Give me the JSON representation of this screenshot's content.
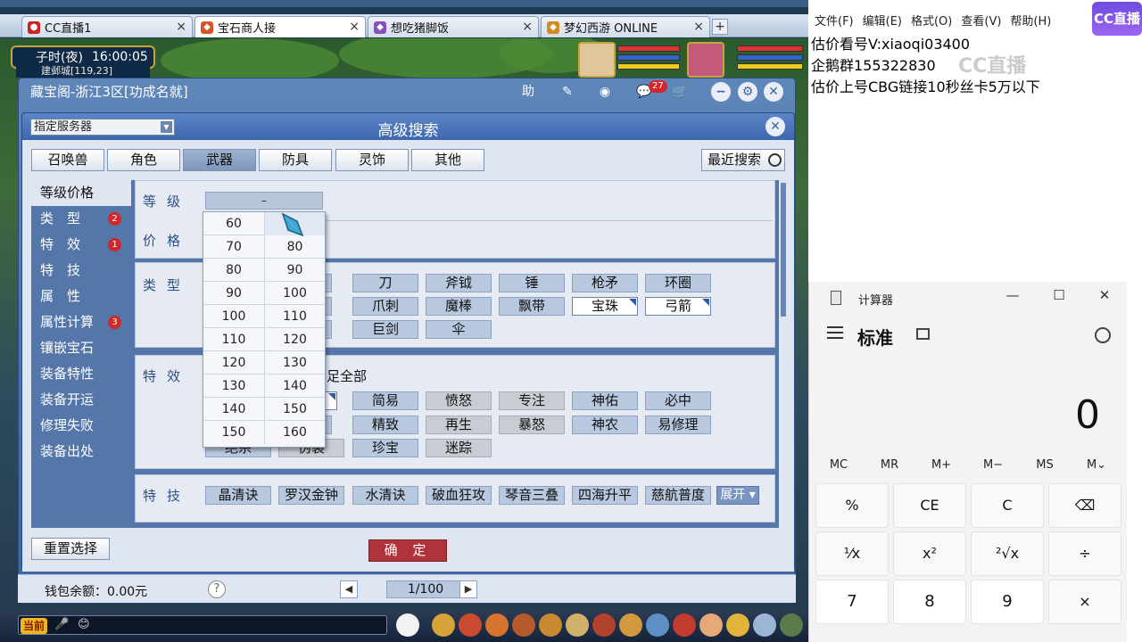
{
  "browser": {
    "tabs": [
      {
        "label": "CC直播1",
        "icon": "cc-live-icon",
        "active": false
      },
      {
        "label": "宝石商人接",
        "icon": "game-tab-icon",
        "active": true
      },
      {
        "label": "想吃猪脚饭",
        "icon": "game-tab-icon",
        "active": false
      },
      {
        "label": "梦幻西游 ONLINE",
        "icon": "game-tab-icon",
        "active": false
      }
    ],
    "new_tab": "+",
    "close_glyph": "×"
  },
  "game_hud": {
    "time_of_day": "子时(夜)",
    "clock": "16:00:05",
    "map_label": "建邺城[119,23]"
  },
  "main_window": {
    "title": "藏宝阁-浙江3区[功成名就]",
    "help_label": "助",
    "message_badge": "27"
  },
  "dialog": {
    "title": "高级搜索",
    "server_select": "指定服务器",
    "categories": [
      "召唤兽",
      "角色",
      "武器",
      "防具",
      "灵饰",
      "其他"
    ],
    "active_category": "武器",
    "recent_search": "最近搜索",
    "left_nav": [
      {
        "label": "等级价格",
        "badge": ""
      },
      {
        "label": "类　型",
        "badge": "2"
      },
      {
        "label": "特　效",
        "badge": "1"
      },
      {
        "label": "特　技",
        "badge": ""
      },
      {
        "label": "属　性",
        "badge": ""
      },
      {
        "label": "属性计算",
        "badge": "3"
      },
      {
        "label": "镶嵌宝石",
        "badge": ""
      },
      {
        "label": "装备特性",
        "badge": ""
      },
      {
        "label": "装备开运",
        "badge": ""
      },
      {
        "label": "修理失败",
        "badge": ""
      },
      {
        "label": "装备出处",
        "badge": ""
      }
    ],
    "level_label": "等级",
    "level_value": "–",
    "price_label": "价格",
    "type_label": "类型",
    "type_chips": [
      [
        "刀",
        "斧钺",
        "锤",
        "枪矛",
        "环圈"
      ],
      [
        "爪刺",
        "魔棒",
        "飘带",
        "宝珠",
        "弓箭"
      ],
      [
        "巨剑",
        "伞"
      ]
    ],
    "effect_label": "特效",
    "effect_satisfy_all": "足全部",
    "effect_chips": [
      [
        "简易",
        "愤怒",
        "专注",
        "神佑",
        "必中"
      ],
      [
        "精致",
        "再生",
        "暴怒",
        "神农",
        "易修理"
      ],
      [
        "珍宝",
        "迷踪"
      ]
    ],
    "effect_partial": [
      "绝杀",
      "伪装"
    ],
    "skill_label": "特技",
    "skill_chips": [
      "晶清诀",
      "罗汉金钟",
      "水清诀",
      "破血狂攻",
      "琴音三叠",
      "四海升平",
      "慈航普度"
    ],
    "expand": "展开",
    "level_dropdown": [
      [
        "60",
        ""
      ],
      [
        "70",
        "80"
      ],
      [
        "80",
        "90"
      ],
      [
        "90",
        "100"
      ],
      [
        "100",
        "110"
      ],
      [
        "110",
        "120"
      ],
      [
        "120",
        "130"
      ],
      [
        "130",
        "140"
      ],
      [
        "140",
        "150"
      ],
      [
        "150",
        "160"
      ]
    ],
    "reset": "重置选择",
    "confirm": "确 定"
  },
  "footer": {
    "wallet": "钱包余额：0.00元",
    "help": "?",
    "page": "1/100"
  },
  "chat": {
    "now_label": "当前"
  },
  "notepad": {
    "menu": [
      "文件(F)",
      "编辑(E)",
      "格式(O)",
      "查看(V)",
      "帮助(H)"
    ],
    "lines": [
      "估价看号V:xiaoqi03400",
      "企鹅群155322830",
      "估价上号CBG链接10秒丝卡5万以下"
    ],
    "watermark": "CC直播",
    "logo": "CC直播"
  },
  "calculator": {
    "title": "计算器",
    "mode": "标准",
    "display": "0",
    "memory": [
      "MC",
      "MR",
      "M+",
      "M−",
      "MS",
      "M⌄"
    ],
    "keys": [
      [
        "%",
        "CE",
        "C",
        "⌫"
      ],
      [
        "¹⁄x",
        "x²",
        "²√x",
        "÷"
      ],
      [
        "7",
        "8",
        "9",
        "×"
      ]
    ],
    "controls": [
      "—",
      "☐",
      "✕"
    ]
  },
  "colors": {
    "accent_red": "#d3262a",
    "confirm_red": "#b0323a",
    "dialog_blue": "#3d65a6"
  }
}
